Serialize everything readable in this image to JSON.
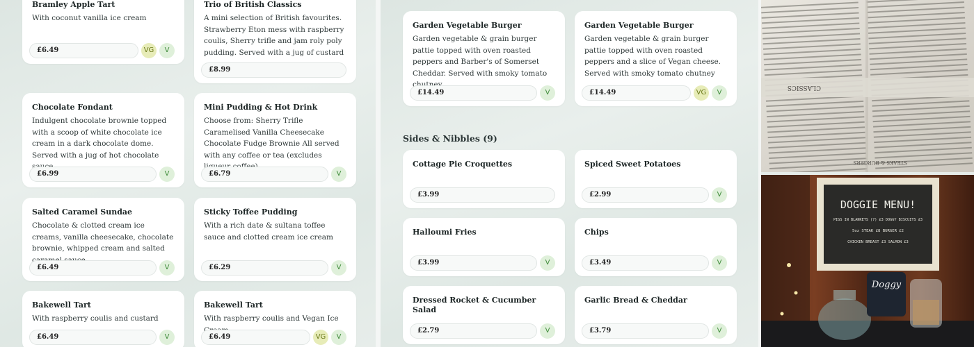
{
  "left_column": [
    {
      "title": "Bramley Apple Tart",
      "desc": "With coconut vanilla ice cream",
      "price": "£6.49",
      "badges": [
        "VG",
        "V"
      ]
    },
    {
      "title": "Trio of British Classics",
      "desc": "A mini selection of British favourites. Strawberry Eton mess with raspberry coulis, Sherry trifle and jam roly poly pudding. Served with a jug of custard",
      "price": "£8.99",
      "badges": []
    },
    {
      "title": "Chocolate Fondant",
      "desc": "Indulgent chocolate brownie topped with a scoop of white chocolate ice cream in a dark chocolate dome. Served with a jug of hot chocolate sauce",
      "price": "£6.99",
      "badges": [
        "V"
      ]
    },
    {
      "title": "Mini Pudding & Hot Drink",
      "desc": "Choose from: Sherry Trifle Caramelised Vanilla Cheesecake Chocolate Fudge Brownie All served with any coffee or tea (excludes liqueur coffee)",
      "price": "£6.79",
      "badges": [
        "V"
      ]
    },
    {
      "title": "Salted Caramel Sundae",
      "desc": "Chocolate & clotted cream ice creams, vanilla cheesecake, chocolate brownie, whipped cream and salted caramel sauce",
      "price": "£6.49",
      "badges": [
        "V"
      ]
    },
    {
      "title": "Sticky Toffee Pudding",
      "desc": "With a rich date & sultana toffee sauce and clotted cream ice cream",
      "price": "£6.29",
      "badges": [
        "V"
      ]
    },
    {
      "title": "Bakewell Tart",
      "desc": "With raspberry coulis and custard",
      "price": "£6.49",
      "badges": [
        "V"
      ]
    },
    {
      "title": "Bakewell Tart",
      "desc": "With raspberry coulis and Vegan Ice Cream",
      "price": "£6.49",
      "badges": [
        "VG",
        "V"
      ]
    }
  ],
  "mid_column": {
    "burgers": [
      {
        "title": "Garden Vegetable Burger",
        "desc": "Garden vegetable & grain burger pattie topped with oven roasted peppers and Barber's of Somerset Cheddar. Served with smoky tomato chutney",
        "price": "£14.49",
        "badges": [
          "V"
        ]
      },
      {
        "title": "Garden Vegetable Burger",
        "desc": "Garden vegetable & grain burger pattie topped with oven roasted peppers and a slice of Vegan cheese. Served with smoky tomato chutney",
        "price": "£14.49",
        "badges": [
          "VG",
          "V"
        ]
      }
    ],
    "sides_title": "Sides & Nibbles (9)",
    "sides": [
      {
        "title": "Cottage Pie Croquettes",
        "price": "£3.99",
        "badges": []
      },
      {
        "title": "Spiced Sweet Potatoes",
        "price": "£2.99",
        "badges": [
          "V"
        ]
      },
      {
        "title": "Halloumi Fries",
        "price": "£3.99",
        "badges": [
          "V"
        ]
      },
      {
        "title": "Chips",
        "price": "£3.49",
        "badges": [
          "V"
        ]
      },
      {
        "title": "Dressed Rocket & Cucumber Salad",
        "price": "£2.79",
        "badges": [
          "V"
        ]
      },
      {
        "title": "Garlic Bread & Cheddar",
        "price": "£3.79",
        "badges": [
          "V"
        ]
      }
    ]
  },
  "photos": {
    "menu_board_heading": "CLASSICS",
    "menu_board_subheading": "STEAKS & BURGERS",
    "doggie_heading": "DOGGIE MENU!",
    "doggie_lines": [
      "PIGS IN BLANKETS (7) £3   DOGGY BISCUITS £3",
      "5oz STEAK £8   BURGER £2",
      "CHICKEN BREAST £3   SALMON £3"
    ],
    "jar_label": "Doggy"
  }
}
